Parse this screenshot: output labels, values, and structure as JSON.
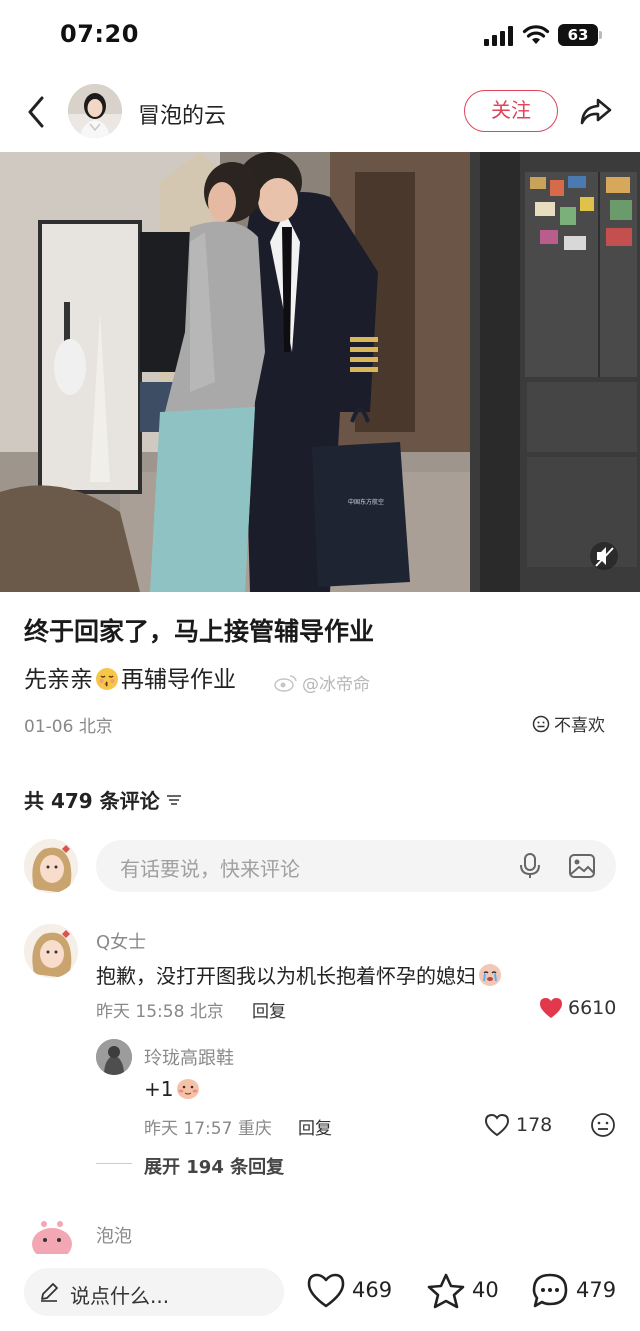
{
  "status_bar": {
    "time": "07:20",
    "battery": "63"
  },
  "header": {
    "author": "冒泡的云",
    "follow_label": "关注"
  },
  "post": {
    "title": "终于回家了，马上接管辅导作业",
    "body_before": "先亲亲",
    "body_after": "再辅导作业",
    "watermark": "@冰帝命",
    "date": "01-06",
    "location": "北京",
    "dislike_label": "不喜欢",
    "bag_text": "中国东方航空"
  },
  "comments": {
    "total_label": "共 479 条评论",
    "input_placeholder": "有话要说，快来评论",
    "items": [
      {
        "author": "Q女士",
        "text": "抱歉，没打开图我以为机长抱着怀孕的媳妇",
        "time": "昨天 15:58",
        "location": "北京",
        "reply_label": "回复",
        "likes": "6610",
        "replies": [
          {
            "author": "玲珑高跟鞋",
            "text": "+1",
            "time": "昨天 17:57",
            "location": "重庆",
            "reply_label": "回复",
            "likes": "178"
          }
        ],
        "expand_label": "展开 194 条回复"
      },
      {
        "author": "泡泡"
      }
    ]
  },
  "bottom_bar": {
    "placeholder": "说点什么...",
    "likes": "469",
    "favorites": "40",
    "comments": "479"
  },
  "colors": {
    "accent": "#e0435a",
    "like_red": "#e3384b"
  }
}
